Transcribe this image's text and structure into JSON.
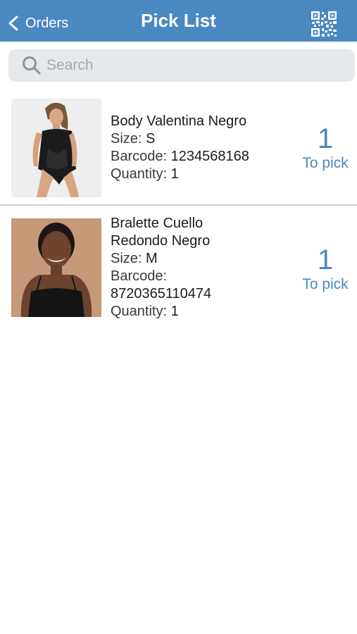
{
  "nav": {
    "back_label": "Orders",
    "title": "Pick List",
    "scan_icon": "qr-code-icon",
    "bar_color": "#4a88c1"
  },
  "search": {
    "placeholder": "Search",
    "value": ""
  },
  "items": [
    {
      "name": "Body Valentina Negro",
      "size_label": "Size:",
      "size": "S",
      "barcode_label": "Barcode:",
      "barcode": "1234568168",
      "quantity_label": "Quantity:",
      "quantity": "1",
      "to_pick_count": "1",
      "to_pick_label": "To pick"
    },
    {
      "name_line1": "Bralette Cuello",
      "name_line2": "Redondo Negro",
      "size_label": "Size:",
      "size": "M",
      "barcode_label": "Barcode:",
      "barcode": "8720365110474",
      "quantity_label": "Quantity:",
      "quantity": "1",
      "to_pick_count": "1",
      "to_pick_label": "To pick"
    }
  ]
}
